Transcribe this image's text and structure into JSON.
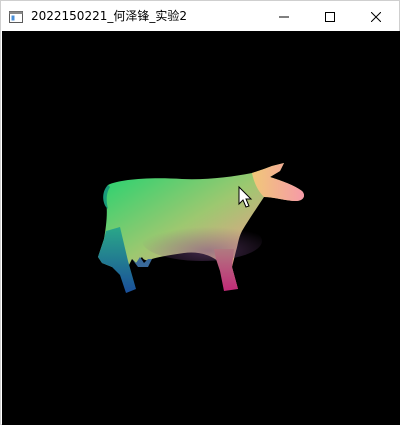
{
  "window": {
    "title": "2022150221_何泽锋_实验2",
    "icon": "app-window-icon",
    "controls": {
      "minimize_icon": "minimize-icon",
      "maximize_icon": "maximize-icon",
      "close_icon": "close-icon"
    }
  },
  "canvas": {
    "background": "#000000",
    "content": "cow-silhouette",
    "gradient_colors": [
      "#1fd86a",
      "#f2c06a",
      "#f08cc0",
      "#c02878",
      "#1b5ea8",
      "#2a8a9a"
    ]
  },
  "cursor": {
    "icon": "mouse-pointer-icon"
  }
}
